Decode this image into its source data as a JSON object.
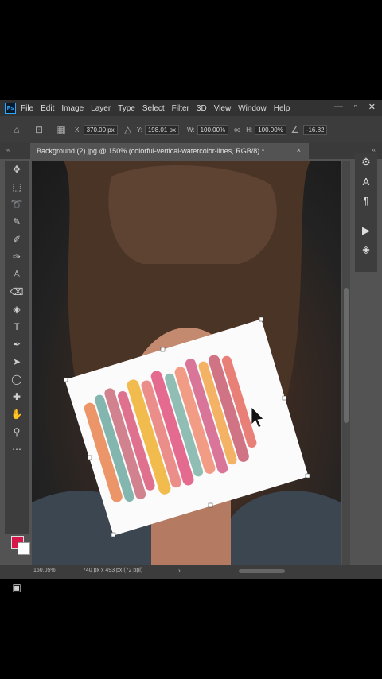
{
  "app": {
    "logo": "Ps",
    "menu": [
      "File",
      "Edit",
      "Image",
      "Layer",
      "Type",
      "Select",
      "Filter",
      "3D",
      "View",
      "Window",
      "Help"
    ],
    "window_controls": {
      "minimize": "—",
      "restore": "▫",
      "close": "✕"
    }
  },
  "options": {
    "x_label": "X:",
    "x_value": "370.00 px",
    "y_label": "Y:",
    "y_value": "198.01 px",
    "w_label": "W:",
    "w_value": "100.00%",
    "h_label": "H:",
    "h_value": "100.00%",
    "angle_value": "-16.82"
  },
  "document": {
    "tab_title": "Background (2).jpg @ 150% (colorful-vertical-watercolor-lines, RGB/8) *",
    "tab_close": "×",
    "collapse_left": "«",
    "collapse_right": "«"
  },
  "status": {
    "zoom": "150.05%",
    "dimensions": "740 px x 493 px (72 ppi)",
    "arrow": "›"
  },
  "colors": {
    "foreground": "#d6174a",
    "background": "#ffffff",
    "accent": "#31a8ff"
  },
  "tools": [
    "move-icon",
    "marquee-icon",
    "lasso-icon",
    "quick-select-icon",
    "eyedropper-icon",
    "brush-icon",
    "stamp-icon",
    "eraser-icon",
    "bucket-icon",
    "type-icon",
    "pen-icon",
    "path-select-icon",
    "ellipse-icon",
    "zoom-icon",
    "hand-icon",
    "magnify-icon",
    "more-icon"
  ],
  "right_tools": [
    "character-panel-icon",
    "type-icon",
    "paragraph-icon",
    "play-icon",
    "layers-icon"
  ],
  "right_glyphs": {
    "r0": "⚙",
    "r1": "A",
    "r2": "¶",
    "r3": "▶",
    "r4": "◈"
  }
}
